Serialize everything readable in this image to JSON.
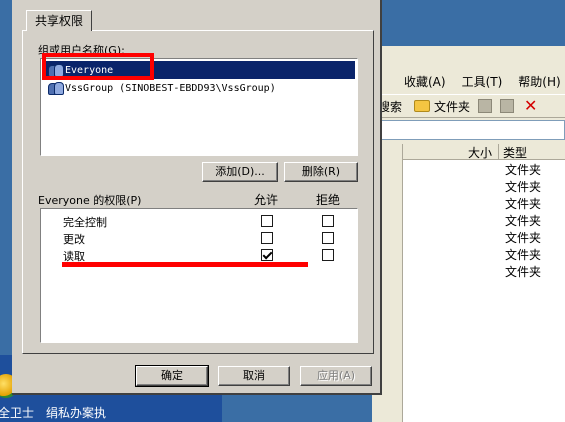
{
  "dialog": {
    "tab": "共享权限",
    "group_label": "组或用户名称(G):",
    "users": [
      {
        "label": "Everyone",
        "selected": true
      },
      {
        "label": "VssGroup (SINOBEST-EBDD93\\VssGroup)",
        "selected": false
      }
    ],
    "add_button": "添加(D)...",
    "remove_button": "删除(R)",
    "permissions_title": "Everyone 的权限(P)",
    "allow_header": "允许",
    "deny_header": "拒绝",
    "permissions": [
      {
        "label": "完全控制",
        "allow": false,
        "deny": false
      },
      {
        "label": "更改",
        "allow": false,
        "deny": false
      },
      {
        "label": "读取",
        "allow": true,
        "deny": false
      }
    ],
    "ok_button": "确定",
    "cancel_button": "取消",
    "apply_button": "应用(A)"
  },
  "explorer": {
    "menu": [
      "收藏(A)",
      "工具(T)",
      "帮助(H)"
    ],
    "toolbar": {
      "search": "搜索",
      "folders": "文件夹"
    },
    "columns": {
      "size": "大小",
      "type": "类型"
    },
    "rows": [
      "文件夹",
      "文件夹",
      "文件夹",
      "文件夹",
      "文件夹",
      "文件夹",
      "文件夹"
    ]
  },
  "desktop": {
    "icons": [
      "全卫士",
      "绢私办案执"
    ]
  },
  "colors": {
    "annotation": "#ff0000",
    "selection": "#0a246a",
    "desktop": "#3a6ea5",
    "dialog_face": "#d4d0c8"
  }
}
